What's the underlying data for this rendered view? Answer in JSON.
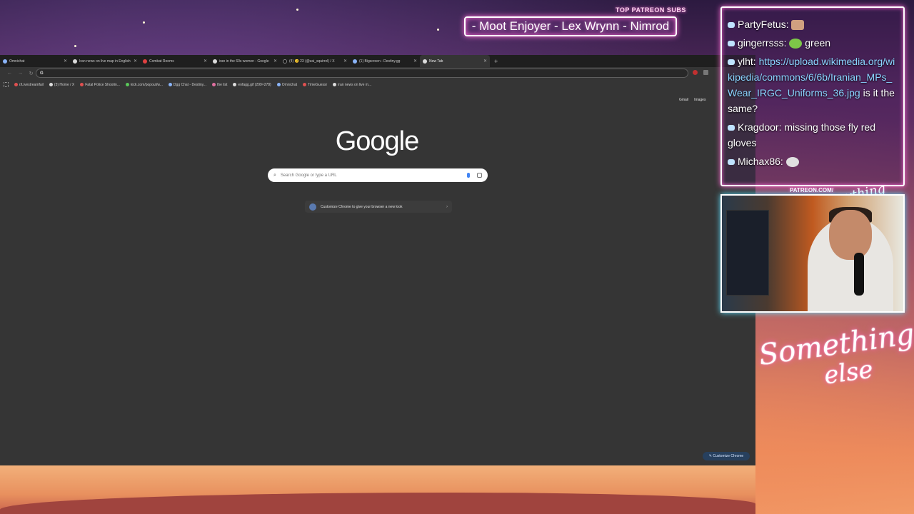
{
  "overlay": {
    "patreon_label": "TOP PATREON SUBS",
    "patreon_names": "- Moot Enjoyer - Lex Wrynn - Nimrod",
    "cam_tag": "PATREON.COM/",
    "cam_brand": "Anything Else",
    "brand_line1": "Something",
    "brand_line2": "else"
  },
  "browser": {
    "tabs": [
      {
        "title": "Omnichat",
        "icon": "chat-icon"
      },
      {
        "title": "Iran news on live map in English",
        "icon": "map-icon"
      },
      {
        "title": "Combat Rooms",
        "icon": "red-icon"
      },
      {
        "title": "iran in the 60s women - Google",
        "icon": "google-icon"
      },
      {
        "title": "(4) 😊 23 (@zai_squirrel) / X",
        "icon": "x-icon"
      },
      {
        "title": "(1) Bigscreen - Destiny.gg",
        "icon": "chat-icon"
      },
      {
        "title": "New Tab",
        "icon": "chrome-icon"
      }
    ],
    "omnibox": {
      "value": "",
      "placeholder": ""
    },
    "bookmarks": [
      {
        "label": "r/Livestreamfail",
        "color": "#e05050"
      },
      {
        "label": "(3) Home / X",
        "color": "#111111"
      },
      {
        "label": "Fatal Police Shootin...",
        "color": "#e04040"
      },
      {
        "label": "kick.com/popout/w...",
        "color": "#5ac85a"
      },
      {
        "label": "Dgg Chat - Destiny...",
        "color": "#8ab4f8"
      },
      {
        "label": "the list",
        "color": "#e070a0"
      },
      {
        "label": "enfagg.gif (299×278)",
        "color": "#dddddd"
      },
      {
        "label": "Omnichat",
        "color": "#8ab4f8"
      },
      {
        "label": "TimeGuessr",
        "color": "#e05050"
      },
      {
        "label": "iran news on live m...",
        "color": "#dddddd"
      }
    ],
    "ntp_links": [
      "Gmail",
      "Images"
    ],
    "google_logo": "Google",
    "search_placeholder": "Search Google or type a URL",
    "customize_chip": "Customize Chrome to give your browser a new look",
    "customize_button": "Customize Chrome"
  },
  "chat": {
    "messages": [
      {
        "user": "PartyFetus:",
        "text": "",
        "emote": "face"
      },
      {
        "user": "gingerrsss:",
        "text": "green",
        "emote": "green"
      },
      {
        "user": "ylht:",
        "text": "",
        "link": "https://upload.wikimedia.org/wikipedia/commons/6/6b/Iranian_MPs_Wear_IRGC_Uniforms_36.jpg",
        "after": "is it the same?"
      },
      {
        "user": "Kragdoor:",
        "text": "missing those fly red gloves"
      },
      {
        "user": "Michax86:",
        "text": "",
        "emote": "ghost"
      }
    ]
  }
}
